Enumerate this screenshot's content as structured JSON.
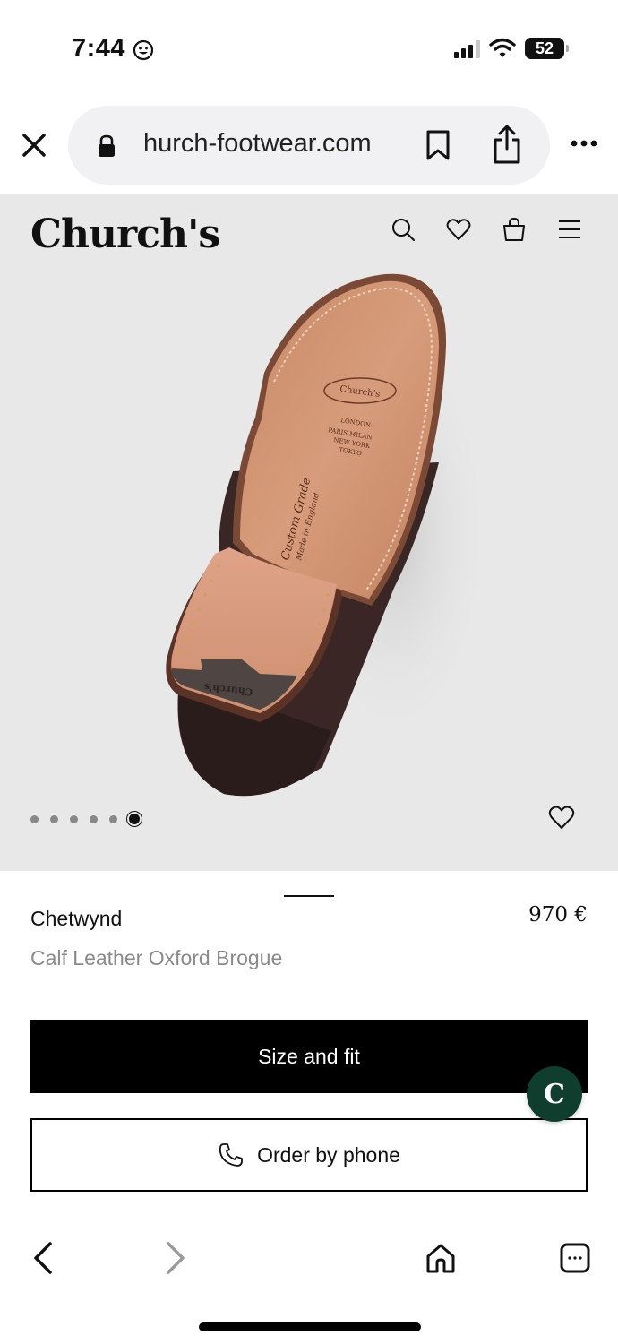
{
  "status_bar": {
    "time": "7:44",
    "battery": "52"
  },
  "browser": {
    "url": "hurch-footwear.com"
  },
  "site": {
    "brand": "Church's"
  },
  "gallery": {
    "image_count": 6,
    "active_index": 5,
    "sole_text": [
      "LONDON",
      "PARIS MILAN",
      "NEW YORK",
      "TOKYO"
    ],
    "sole_grade": "Custom Grade",
    "sole_made": "Made in England",
    "sole_logo": "Church's"
  },
  "product": {
    "name": "Chetwynd",
    "price": "970 €",
    "subtitle": "Calf Leather Oxford Brogue"
  },
  "actions": {
    "size_fit_label": "Size and fit",
    "order_phone_label": "Order by phone"
  },
  "colors": {
    "hero_bg": "#e8e8e9",
    "chat_fab": "#0f3d2e",
    "subtitle_gray": "#8a8a8a"
  }
}
